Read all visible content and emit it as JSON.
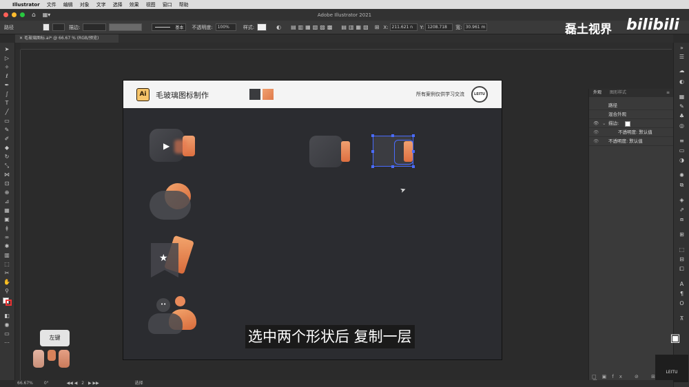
{
  "menubar": {
    "app_name": "Illustrator",
    "items": [
      "文件",
      "编辑",
      "对象",
      "文字",
      "选择",
      "效果",
      "视图",
      "窗口",
      "帮助"
    ]
  },
  "titlebar": {
    "title": "Adobe Illustrator 2021"
  },
  "control_bar": {
    "label": "路径",
    "stroke_label": "描边:",
    "stroke_style": "基本",
    "opacity_label": "不透明度:",
    "opacity_value": "100%",
    "style_label": "样式:",
    "x_label": "X:",
    "x_value": "211.621 n",
    "y_label": "Y:",
    "y_value": "1208.718",
    "w_label": "宽:",
    "w_value": "30.961 m"
  },
  "document_tab": {
    "label": "毛玻璃图标.ai* @ 66.67 % (RGB/预览)"
  },
  "artboard": {
    "logo_text": "Ai",
    "title": "毛玻璃图标制作",
    "credit": "所有案例仅供学习交流",
    "seal_text": "LEITU",
    "swatches": [
      "#3a3b3e",
      "#e98a5a"
    ]
  },
  "appearance_panel": {
    "tab_active": "外观",
    "tab_other": "图形样式",
    "rows": [
      "路径",
      "混合外观",
      "描边:",
      "不透明度: 默认值",
      "不透明度: 默认值"
    ]
  },
  "subtitle": "选中两个形状后 复制一层",
  "watermark": {
    "channel": "磊土视界",
    "site": "bilibili"
  },
  "key_hint": "左键",
  "status_bar": {
    "zoom": "66.67%",
    "angle": "0°",
    "page": "2",
    "tool": "选择"
  },
  "colors": {
    "accent_orange": "#e98a5a",
    "glass_dark": "#3c3d41",
    "selection": "#4a6cff"
  }
}
